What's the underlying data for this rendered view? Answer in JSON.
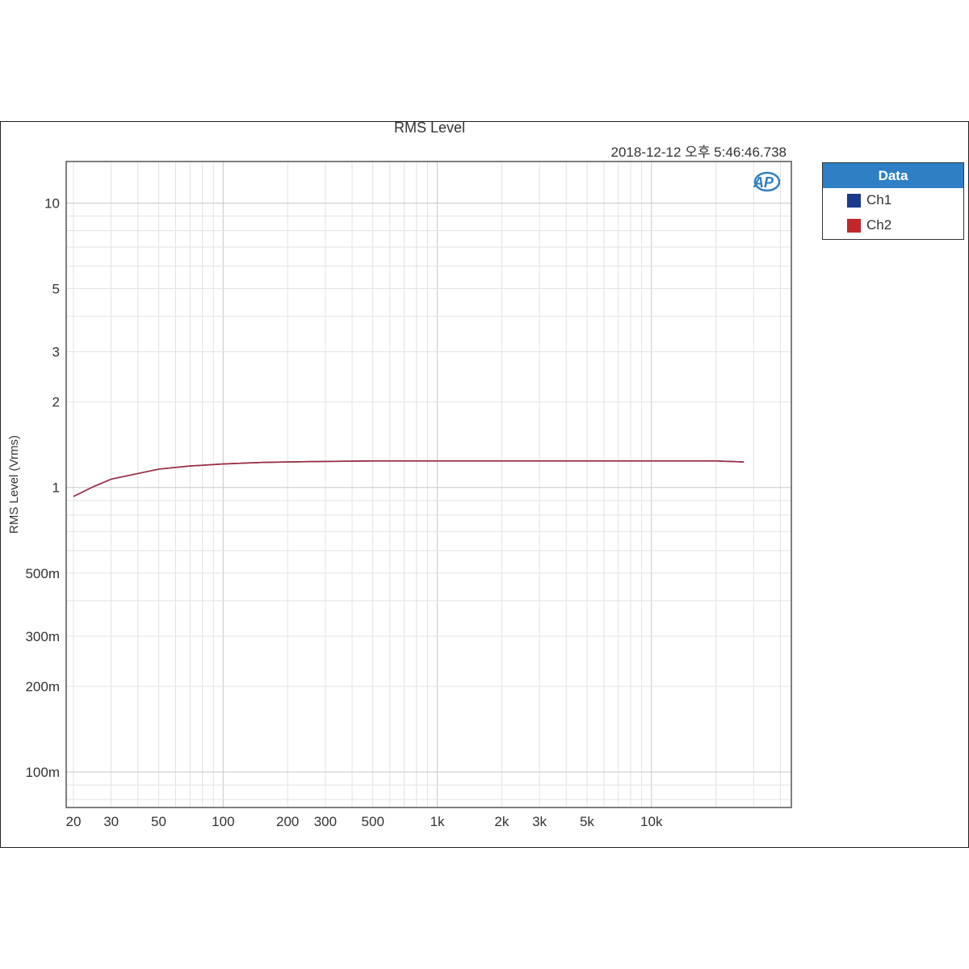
{
  "chart_data": {
    "type": "line",
    "title": "RMS Level",
    "timestamp": "2018-12-12 오후 5:46:46.738",
    "ylabel": "RMS Level (Vrms)",
    "xlabel": "",
    "x_scale": "log",
    "y_scale": "log",
    "xlim": [
      18.5,
      45000
    ],
    "ylim": [
      0.075,
      14
    ],
    "x_ticks": [
      {
        "value": 20,
        "label": "20"
      },
      {
        "value": 30,
        "label": "30"
      },
      {
        "value": 50,
        "label": "50"
      },
      {
        "value": 100,
        "label": "100"
      },
      {
        "value": 200,
        "label": "200"
      },
      {
        "value": 300,
        "label": "300"
      },
      {
        "value": 500,
        "label": "500"
      },
      {
        "value": 1000,
        "label": "1k"
      },
      {
        "value": 2000,
        "label": "2k"
      },
      {
        "value": 3000,
        "label": "3k"
      },
      {
        "value": 5000,
        "label": "5k"
      },
      {
        "value": 10000,
        "label": "10k"
      }
    ],
    "y_ticks": [
      {
        "value": 10,
        "label": "10"
      },
      {
        "value": 5,
        "label": "5"
      },
      {
        "value": 3,
        "label": "3"
      },
      {
        "value": 2,
        "label": "2"
      },
      {
        "value": 1,
        "label": "1"
      },
      {
        "value": 0.5,
        "label": "500m"
      },
      {
        "value": 0.3,
        "label": "300m"
      },
      {
        "value": 0.2,
        "label": "200m"
      },
      {
        "value": 0.1,
        "label": "100m"
      }
    ],
    "grid": true,
    "legend": {
      "title": "Data",
      "position": "right"
    },
    "series": [
      {
        "name": "Ch1",
        "color": "#1a3a8c",
        "x": [
          20,
          25,
          30,
          40,
          50,
          70,
          100,
          150,
          200,
          300,
          500,
          1000,
          2000,
          5000,
          10000,
          20000,
          27000
        ],
        "y": [
          0.93,
          1.01,
          1.07,
          1.12,
          1.16,
          1.19,
          1.21,
          1.225,
          1.23,
          1.235,
          1.24,
          1.24,
          1.24,
          1.24,
          1.24,
          1.24,
          1.23
        ]
      },
      {
        "name": "Ch2",
        "color": "#c0282c",
        "x": [
          20,
          25,
          30,
          40,
          50,
          70,
          100,
          150,
          200,
          300,
          500,
          1000,
          2000,
          5000,
          10000,
          20000,
          27000
        ],
        "y": [
          0.93,
          1.01,
          1.07,
          1.12,
          1.16,
          1.19,
          1.21,
          1.225,
          1.23,
          1.235,
          1.24,
          1.24,
          1.24,
          1.24,
          1.24,
          1.24,
          1.23
        ]
      }
    ]
  },
  "logo": {
    "text": "AP",
    "color": "#2e7fc4"
  }
}
